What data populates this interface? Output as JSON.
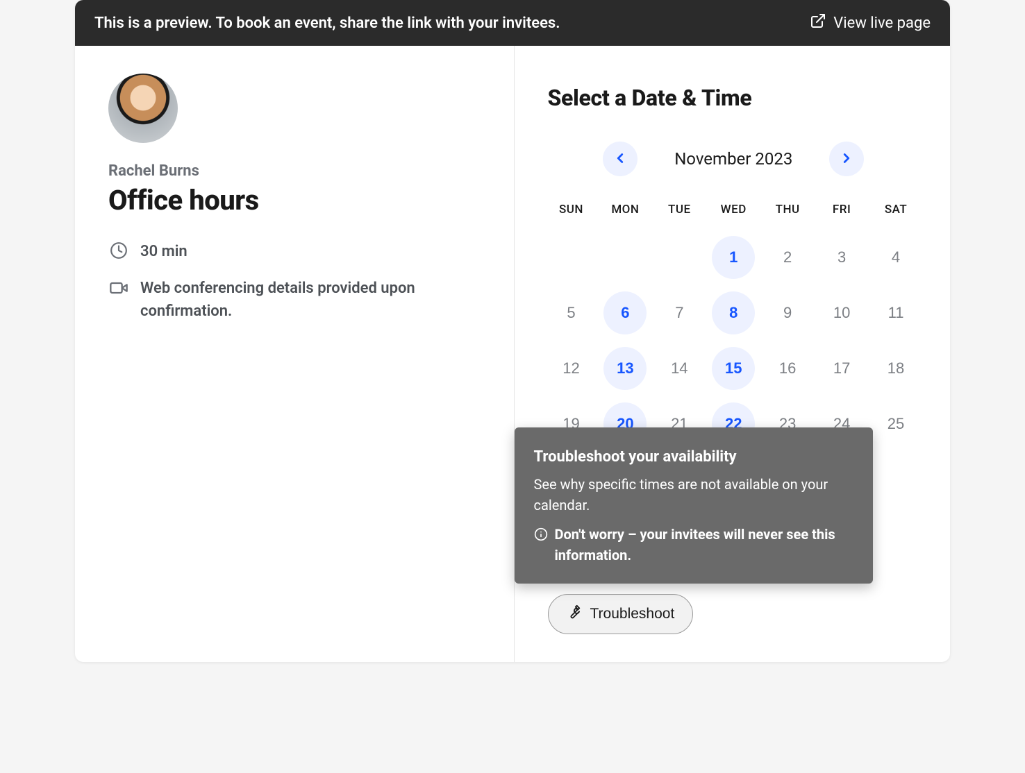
{
  "banner": {
    "text": "This is a preview. To book an event, share the link with your invitees.",
    "link_label": "View live page"
  },
  "event": {
    "host_name": "Rachel Burns",
    "title": "Office hours",
    "duration": "30 min",
    "location": "Web conferencing details provided upon confirmation."
  },
  "calendar": {
    "select_title": "Select a Date & Time",
    "month_label": "November 2023",
    "dow": [
      "SUN",
      "MON",
      "TUE",
      "WED",
      "THU",
      "FRI",
      "SAT"
    ],
    "weeks": [
      [
        null,
        null,
        null,
        {
          "n": "1",
          "available": true
        },
        {
          "n": "2",
          "available": false
        },
        {
          "n": "3",
          "available": false
        },
        {
          "n": "4",
          "available": false
        }
      ],
      [
        {
          "n": "5",
          "available": false
        },
        {
          "n": "6",
          "available": true
        },
        {
          "n": "7",
          "available": false
        },
        {
          "n": "8",
          "available": true
        },
        {
          "n": "9",
          "available": false
        },
        {
          "n": "10",
          "available": false
        },
        {
          "n": "11",
          "available": false
        }
      ],
      [
        {
          "n": "12",
          "available": false
        },
        {
          "n": "13",
          "available": true
        },
        {
          "n": "14",
          "available": false
        },
        {
          "n": "15",
          "available": true
        },
        {
          "n": "16",
          "available": false
        },
        {
          "n": "17",
          "available": false
        },
        {
          "n": "18",
          "available": false
        }
      ],
      [
        {
          "n": "19",
          "available": false
        },
        {
          "n": "20",
          "available": true
        },
        {
          "n": "21",
          "available": false
        },
        {
          "n": "22",
          "available": true
        },
        {
          "n": "23",
          "available": false
        },
        {
          "n": "24",
          "available": false
        },
        {
          "n": "25",
          "available": false
        }
      ]
    ]
  },
  "tooltip": {
    "title": "Troubleshoot your availability",
    "subtitle": "See why specific times are not available on your calendar.",
    "note": "Don't worry – your invitees will never see this information."
  },
  "troubleshoot_label": "Troubleshoot"
}
